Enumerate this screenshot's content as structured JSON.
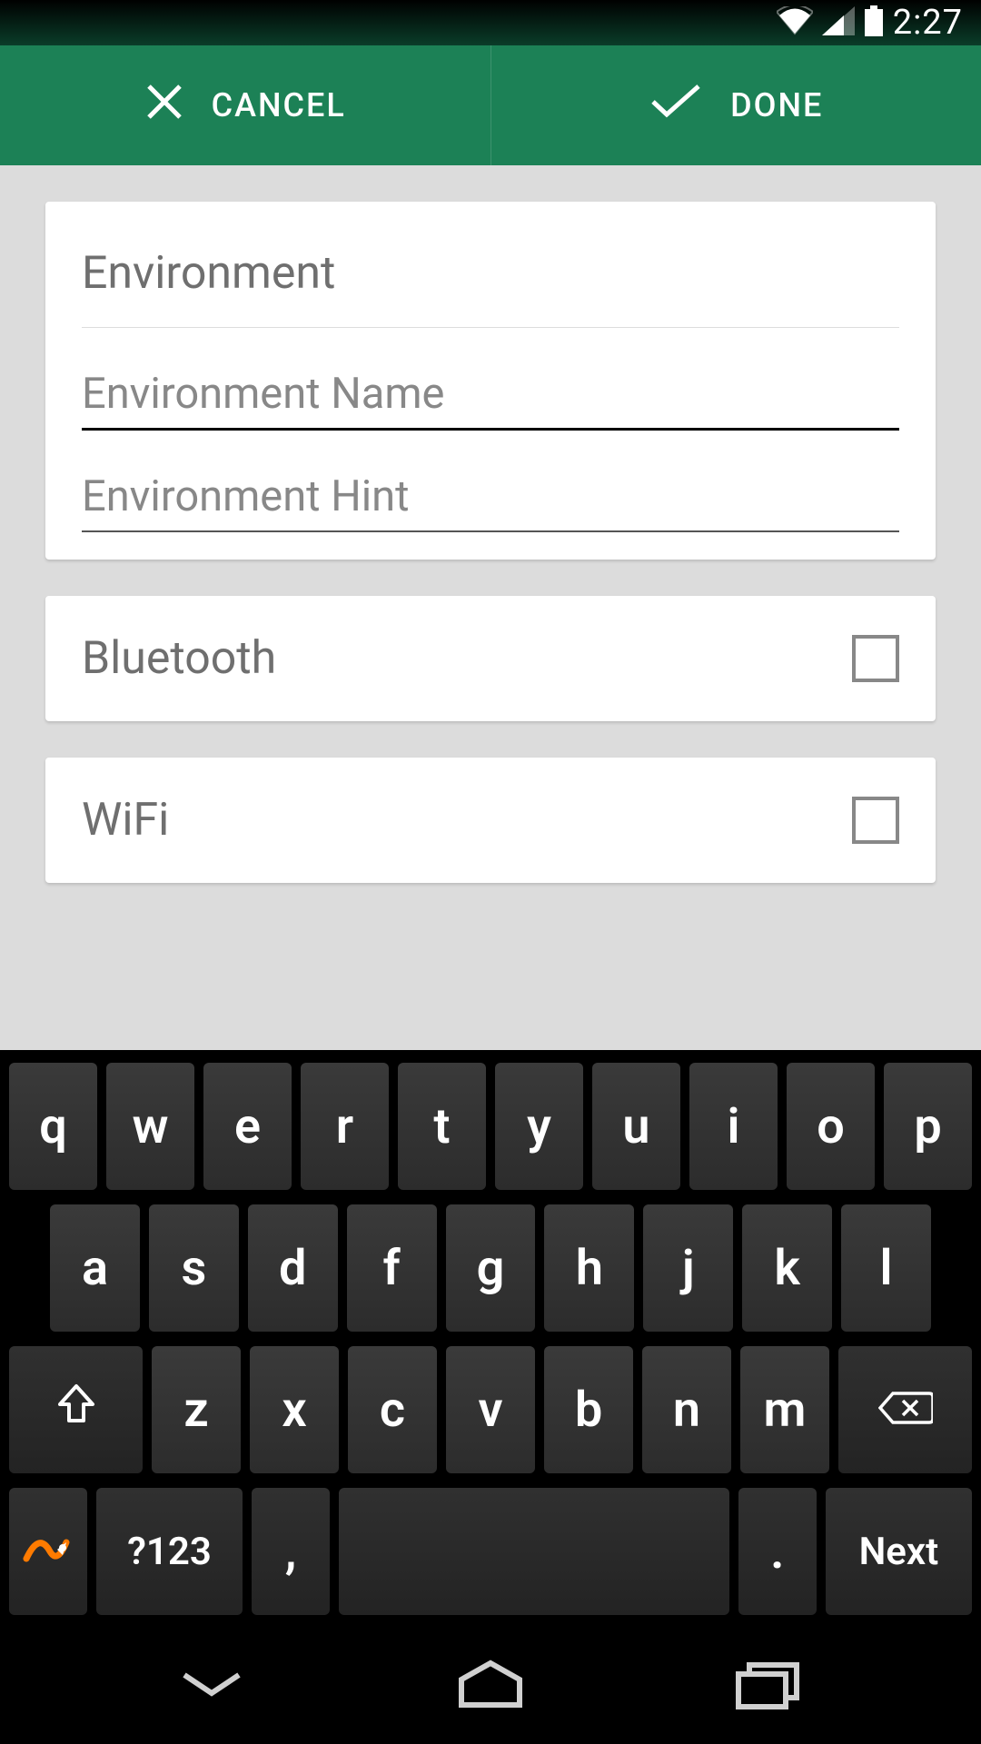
{
  "statusbar": {
    "time": "2:27"
  },
  "actionbar": {
    "cancel_label": "CANCEL",
    "done_label": "DONE"
  },
  "form": {
    "title": "Environment",
    "name_placeholder": "Environment Name",
    "name_value": "",
    "hint_placeholder": "Environment Hint",
    "hint_value": ""
  },
  "toggles": [
    {
      "label": "Bluetooth",
      "checked": false
    },
    {
      "label": "WiFi",
      "checked": false
    }
  ],
  "keyboard": {
    "row1": [
      "q",
      "w",
      "e",
      "r",
      "t",
      "y",
      "u",
      "i",
      "o",
      "p"
    ],
    "row2": [
      "a",
      "s",
      "d",
      "f",
      "g",
      "h",
      "j",
      "k",
      "l"
    ],
    "row3": [
      "z",
      "x",
      "c",
      "v",
      "b",
      "n",
      "m"
    ],
    "sym_label": "?123",
    "comma": ",",
    "period": ".",
    "next_label": "Next"
  }
}
